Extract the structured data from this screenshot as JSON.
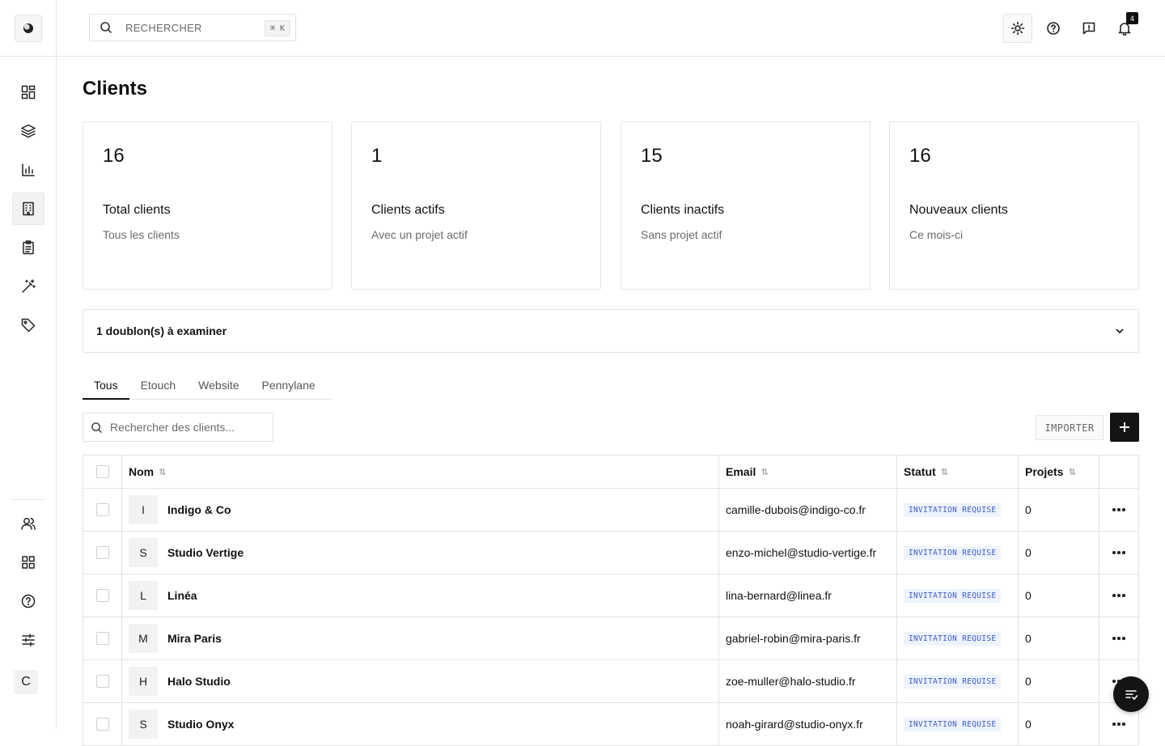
{
  "search": {
    "placeholder": "RECHERCHER",
    "shortcut": "⌘ K"
  },
  "notifications": {
    "count": "4"
  },
  "sidebar": {
    "items": [
      {
        "icon": "dashboard-grid-icon"
      },
      {
        "icon": "layers-icon"
      },
      {
        "icon": "bar-chart-icon"
      },
      {
        "icon": "building-icon",
        "active": true
      },
      {
        "icon": "clipboard-icon"
      },
      {
        "icon": "magic-wand-icon"
      },
      {
        "icon": "tag-icon"
      }
    ],
    "bottom_items": [
      {
        "icon": "users-icon"
      },
      {
        "icon": "apps-grid-icon"
      },
      {
        "icon": "help-circle-icon"
      },
      {
        "icon": "sliders-icon"
      }
    ],
    "avatar_initial": "C"
  },
  "page": {
    "title": "Clients"
  },
  "stats": [
    {
      "value": "16",
      "label": "Total clients",
      "sub": "Tous les clients"
    },
    {
      "value": "1",
      "label": "Clients actifs",
      "sub": "Avec un projet actif"
    },
    {
      "value": "15",
      "label": "Clients inactifs",
      "sub": "Sans projet actif"
    },
    {
      "value": "16",
      "label": "Nouveaux clients",
      "sub": "Ce mois-ci"
    }
  ],
  "duplicates": {
    "label": "1 doublon(s) à examiner"
  },
  "tabs": [
    {
      "label": "Tous",
      "active": true
    },
    {
      "label": "Etouch"
    },
    {
      "label": "Website"
    },
    {
      "label": "Pennylane"
    }
  ],
  "list": {
    "search_placeholder": "Rechercher des clients...",
    "import_label": "IMPORTER"
  },
  "table": {
    "headers": {
      "name": "Nom",
      "email": "Email",
      "status": "Statut",
      "projects": "Projets"
    },
    "rows": [
      {
        "initial": "I",
        "name": "Indigo & Co",
        "email": "camille-dubois@indigo-co.fr",
        "status": "INVITATION REQUISE",
        "projects": "0"
      },
      {
        "initial": "S",
        "name": "Studio Vertige",
        "email": "enzo-michel@studio-vertige.fr",
        "status": "INVITATION REQUISE",
        "projects": "0"
      },
      {
        "initial": "L",
        "name": "Linéa",
        "email": "lina-bernard@linea.fr",
        "status": "INVITATION REQUISE",
        "projects": "0"
      },
      {
        "initial": "M",
        "name": "Mira Paris",
        "email": "gabriel-robin@mira-paris.fr",
        "status": "INVITATION REQUISE",
        "projects": "0"
      },
      {
        "initial": "H",
        "name": "Halo Studio",
        "email": "zoe-muller@halo-studio.fr",
        "status": "INVITATION REQUISE",
        "projects": "0"
      },
      {
        "initial": "S",
        "name": "Studio Onyx",
        "email": "noah-girard@studio-onyx.fr",
        "status": "INVITATION REQUISE",
        "projects": "0"
      }
    ]
  },
  "colors": {
    "accent": "#141414",
    "badge_bg": "#eef3fd",
    "badge_text": "#3b5ccc"
  }
}
